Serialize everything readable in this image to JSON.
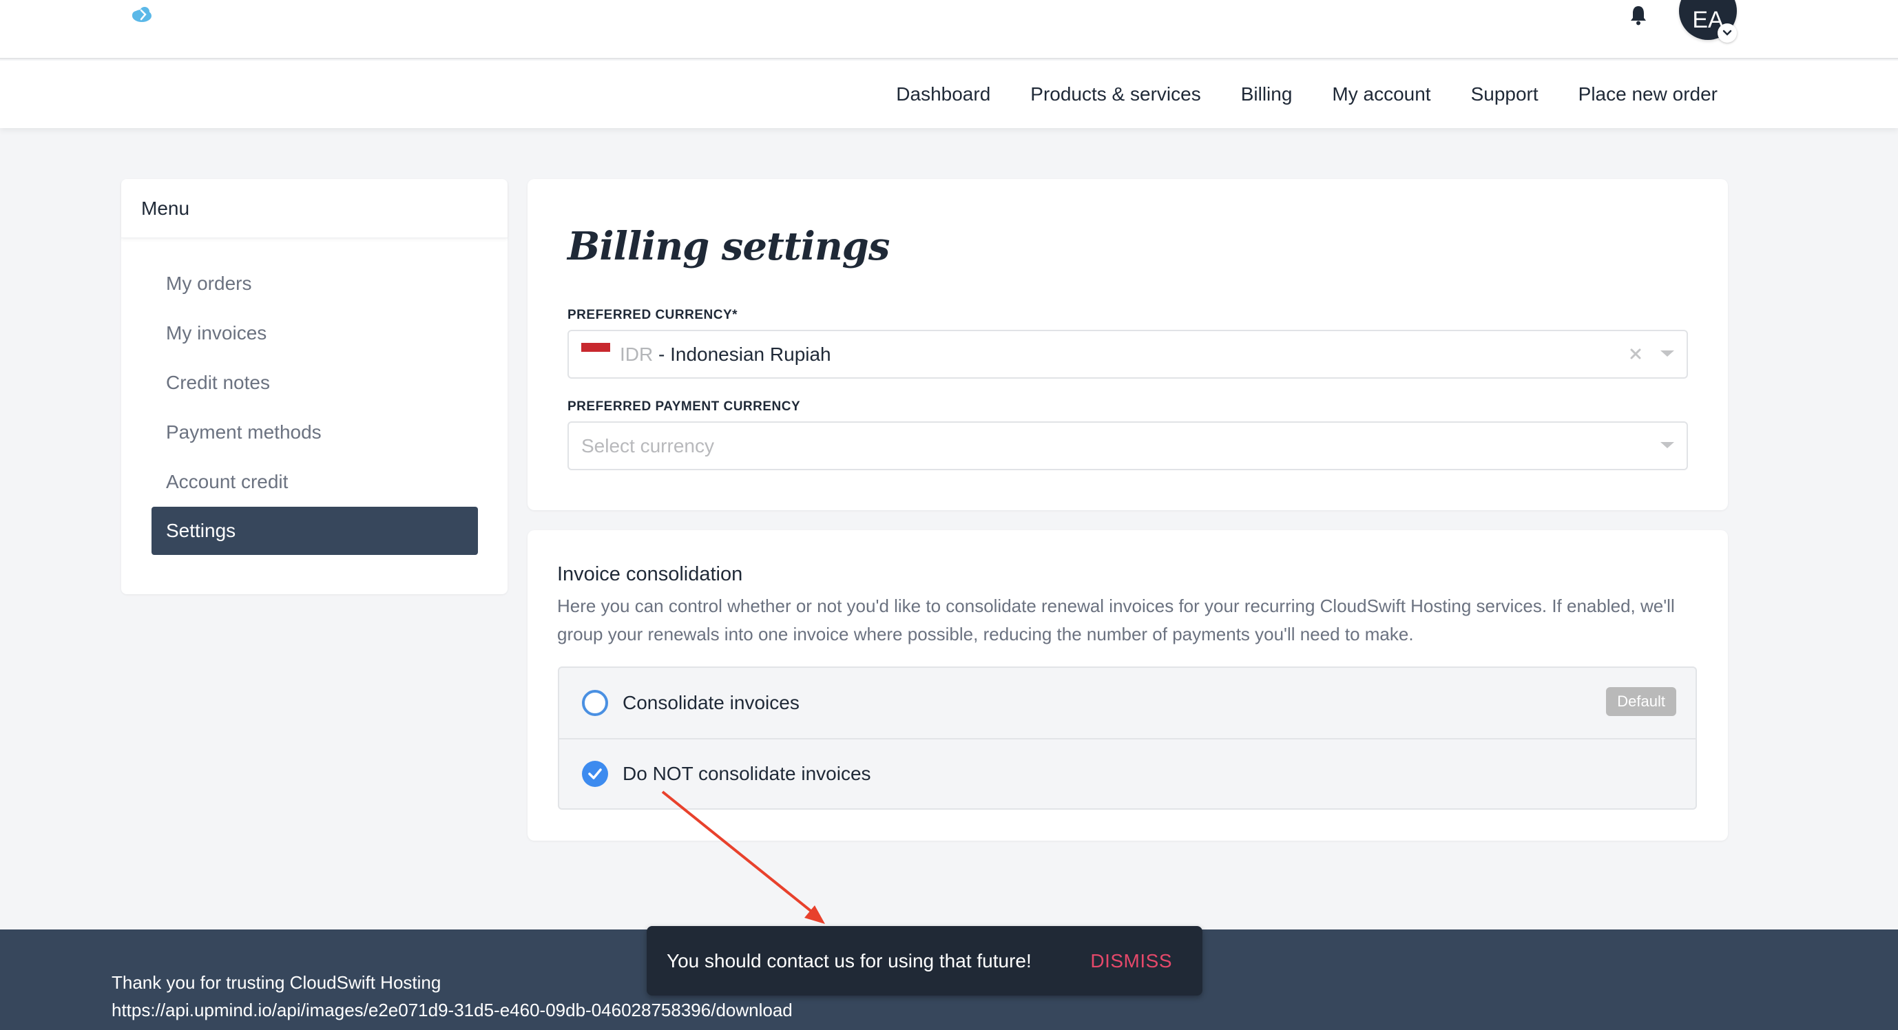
{
  "header": {
    "logo": "cloudswift-logo",
    "notification_icon": "bell-icon",
    "avatar_initials": "EA",
    "avatar_menu_icon": "chevron-down-icon"
  },
  "nav": {
    "items": [
      {
        "label": "Dashboard"
      },
      {
        "label": "Products & services"
      },
      {
        "label": "Billing"
      },
      {
        "label": "My account"
      },
      {
        "label": "Support"
      },
      {
        "label": "Place new order"
      }
    ]
  },
  "sidebar": {
    "title": "Menu",
    "items": [
      {
        "label": "My orders",
        "active": false
      },
      {
        "label": "My invoices",
        "active": false
      },
      {
        "label": "Credit notes",
        "active": false
      },
      {
        "label": "Payment methods",
        "active": false
      },
      {
        "label": "Account credit",
        "active": false
      },
      {
        "label": "Settings",
        "active": true
      }
    ]
  },
  "billing_settings": {
    "title": "Billing settings",
    "preferred_currency": {
      "label": "PREFERRED CURRENCY*",
      "flag": "indonesia-flag",
      "code": "IDR",
      "name": " - Indonesian Rupiah"
    },
    "preferred_payment_currency": {
      "label": "PREFERRED PAYMENT CURRENCY",
      "placeholder": "Select currency"
    }
  },
  "invoice_consolidation": {
    "title": "Invoice consolidation",
    "description": "Here you can control whether or not you'd like to consolidate renewal invoices for your recurring CloudSwift Hosting services. If enabled, we'll group your renewals into one invoice where possible, reducing the number of payments you'll need to make.",
    "options": [
      {
        "label": "Consolidate invoices",
        "selected": false,
        "badge": "Default"
      },
      {
        "label": "Do NOT consolidate invoices",
        "selected": true
      }
    ]
  },
  "footer": {
    "line1": "Thank you for trusting CloudSwift Hosting",
    "line2": "https://api.upmind.io/api/images/e2e071d9-31d5-e460-09db-046028758396/download"
  },
  "toast": {
    "message": "You should contact us for using that future!",
    "action": "DISMISS"
  },
  "colors": {
    "primary_dark": "#37475c",
    "toast_bg": "#202936",
    "accent_blue": "#3d8bef",
    "dismiss": "#e5486a",
    "annotation_arrow": "#e8412c"
  }
}
